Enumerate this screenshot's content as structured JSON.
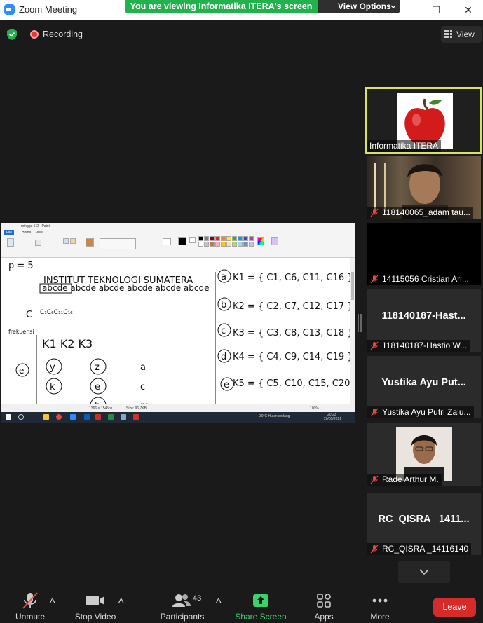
{
  "window": {
    "title": "Zoom Meeting",
    "controls": [
      "–",
      "☐",
      "✕"
    ]
  },
  "share_banner": {
    "text": "You are viewing Informatika ITERA's screen",
    "view_options": "View Options"
  },
  "status": {
    "recording": "Recording",
    "view": "View"
  },
  "shared_screen": {
    "app_title": "minggu 5-2 - Paint",
    "tabs": [
      "File",
      "Home",
      "View"
    ],
    "whiteboard_lines": [
      "p = 5",
      "INSTITUT TEKNOLOGI SUMATERA",
      "abcde abcde abcde abcde abcde abcde",
      "K1 = { C1, C6, C11, C16 }",
      "K2 = { C2, C7, C12, C17 }",
      "K3 = { C3, C8, C13, C18 }",
      "K4 = { C4, C9, C14, C19 }",
      "K5 = { C5, C10, C15, C20 }",
      "frekuensi",
      "K1   K2   K3"
    ],
    "status_bar": {
      "dims": "1366 × 1545px",
      "size": "Size: 96,7KB",
      "zoom": "100%"
    },
    "taskbar": {
      "weather": "30°C  Hujan sedang",
      "time": "20:23",
      "date": "20/05/2021"
    }
  },
  "participants_gallery": [
    {
      "name": "Informatika ITERA",
      "type": "apple",
      "active": true,
      "muted": false
    },
    {
      "name": "118140065_adam tau...",
      "type": "camera-person",
      "active": false,
      "muted": true
    },
    {
      "name": "14115056 Cristian Ari...",
      "type": "black",
      "active": false,
      "muted": true
    },
    {
      "name": "118140187-Hastio W...",
      "big_name": "118140187-Hast...",
      "type": "text",
      "active": false,
      "muted": true
    },
    {
      "name": "Yustika Ayu Putri Zalu...",
      "big_name": "Yustika Ayu Put...",
      "type": "text",
      "active": false,
      "muted": true
    },
    {
      "name": "Rade Arthur M.",
      "type": "photo-person",
      "active": false,
      "muted": true
    },
    {
      "name": "RC_QISRA _14116140",
      "big_name": "RC_QISRA _1411...",
      "type": "text",
      "active": false,
      "muted": true
    }
  ],
  "toolbar": {
    "unmute": "Unmute",
    "stop_video": "Stop Video",
    "participants": "Participants",
    "participant_count": "43",
    "share_screen": "Share Screen",
    "apps": "Apps",
    "more": "More",
    "leave": "Leave"
  },
  "colors": {
    "zoom_blue": "#2d8cff",
    "banner_green": "#23b14d",
    "active_border": "#d8e35a",
    "leave_red": "#d62b2b",
    "muted_red": "#e34848"
  }
}
